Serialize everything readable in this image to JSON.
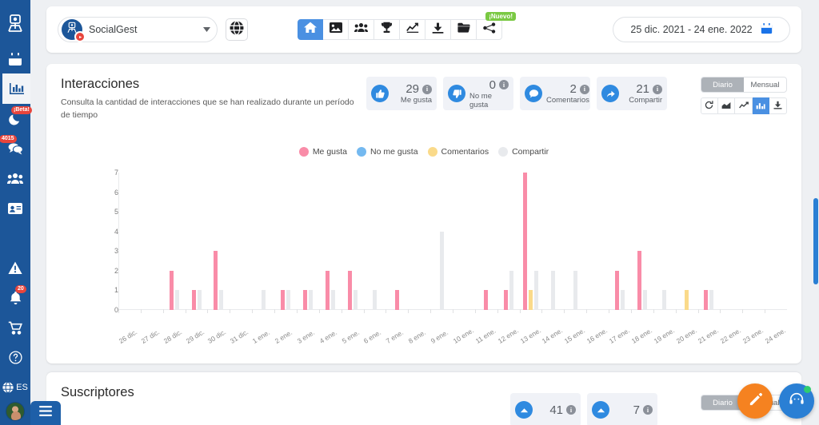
{
  "sidebar": {
    "items": [
      {
        "name": "logo",
        "icon": "logo-icon",
        "badge": null
      },
      {
        "name": "calendar",
        "icon": "calendar-icon",
        "badge": null
      },
      {
        "name": "analytics",
        "icon": "bar-chart-icon",
        "badge": null,
        "active": true
      },
      {
        "name": "moon",
        "icon": "moon-icon",
        "badge": "¡Beta!"
      },
      {
        "name": "messages",
        "icon": "chat-bubbles-icon",
        "badge": "4015"
      },
      {
        "name": "audience",
        "icon": "users-icon",
        "badge": null
      },
      {
        "name": "contacts",
        "icon": "id-card-icon",
        "badge": null
      },
      {
        "name": "alerts",
        "icon": "warning-triangle-icon",
        "badge": null
      },
      {
        "name": "notifications",
        "icon": "bell-icon",
        "badge": "20"
      },
      {
        "name": "store",
        "icon": "shopping-cart-icon",
        "badge": null
      },
      {
        "name": "help",
        "icon": "question-circle-icon",
        "badge": null
      }
    ],
    "language": "ES",
    "language_icon": "globe-icon",
    "avatar_name": "user-avatar",
    "menu_icon": "hamburger-menu-icon"
  },
  "topbar": {
    "account": {
      "name": "SocialGest",
      "avatar_icon": "socialgest-logo-icon",
      "platform_badge_icon": "youtube-icon",
      "chevron_icon": "chevron-down-icon"
    },
    "globe_button_icon": "globe-icon",
    "nav": [
      {
        "name": "home",
        "icon": "home-icon",
        "active": true
      },
      {
        "name": "publications",
        "icon": "image-icon",
        "active": false
      },
      {
        "name": "audience",
        "icon": "users-group-icon",
        "active": false
      },
      {
        "name": "competition",
        "icon": "trophy-icon",
        "active": false
      },
      {
        "name": "statistics",
        "icon": "line-chart-icon",
        "active": false
      },
      {
        "name": "downloads",
        "icon": "download-icon",
        "active": false
      },
      {
        "name": "library",
        "icon": "folder-icon",
        "active": false
      },
      {
        "name": "network",
        "icon": "share-network-icon",
        "active": false,
        "badge": "¡Nuevo!"
      }
    ],
    "date_range": "25 dic. 2021 - 24 ene. 2022",
    "date_icon": "calendar-icon"
  },
  "interactions_card": {
    "title": "Interacciones",
    "subtitle": "Consulta la cantidad de interacciones que se han realizado durante un período de tiempo",
    "stats": [
      {
        "value": "29",
        "label": "Me gusta",
        "icon": "thumbs-up-icon",
        "info_icon": "info-icon"
      },
      {
        "value": "0",
        "label": "No me gusta",
        "icon": "thumbs-down-icon",
        "info_icon": "info-icon"
      },
      {
        "value": "2",
        "label": "Comentarios",
        "icon": "comment-icon",
        "info_icon": "info-icon"
      },
      {
        "value": "21",
        "label": "Compartir",
        "icon": "share-arrow-icon",
        "info_icon": "info-icon"
      }
    ],
    "period_toggle": {
      "options": [
        "Diario",
        "Mensual"
      ],
      "selected": "Diario"
    },
    "chart_tools": [
      {
        "name": "refresh",
        "icon": "refresh-icon",
        "active": false
      },
      {
        "name": "area-chart",
        "icon": "area-chart-icon",
        "active": false
      },
      {
        "name": "line-chart",
        "icon": "line-chart-icon",
        "active": false
      },
      {
        "name": "bar-chart",
        "icon": "bar-chart-icon",
        "active": true
      },
      {
        "name": "export",
        "icon": "download-icon",
        "active": false
      }
    ]
  },
  "subscribers_card": {
    "title": "Suscriptores",
    "stats": [
      {
        "value": "41",
        "label": "",
        "icon": "subscriber-up-icon",
        "info_icon": "info-icon"
      },
      {
        "value": "7",
        "label": "",
        "icon": "subscriber-down-icon",
        "info_icon": "info-icon"
      }
    ],
    "period_toggle": {
      "options": [
        "Diario",
        "Mensual"
      ],
      "selected": "Diario"
    }
  },
  "fabs": [
    {
      "name": "compose",
      "icon": "pencil-icon",
      "color": "#f58220"
    },
    {
      "name": "support-chat",
      "icon": "chat-support-icon",
      "color": "#2a7fd4",
      "status_dot": "#2ecc71"
    }
  ],
  "colors": {
    "sidebar": "#1c5699",
    "accent_blue": "#4a90e2",
    "me_gusta": "#f98ca8",
    "no_me_gusta": "#74b9f0",
    "comentarios": "#fada8a",
    "compartir": "#e8eaed",
    "badge_red": "#e8453c",
    "badge_green": "#7ac943",
    "fab_orange": "#f58220"
  },
  "chart_data": {
    "type": "bar",
    "title": "Interacciones",
    "xlabel": "",
    "ylabel": "",
    "ylim": [
      0,
      7
    ],
    "yticks": [
      0,
      1,
      2,
      3,
      4,
      5,
      6,
      7
    ],
    "grid": false,
    "legend_position": "top-center",
    "categories": [
      "26 dic.",
      "27 dic.",
      "28 dic.",
      "29 dic.",
      "30 dic.",
      "31 dic.",
      "1 ene.",
      "2 ene.",
      "3 ene.",
      "4 ene.",
      "5 ene.",
      "6 ene.",
      "7 ene.",
      "8 ene.",
      "9 ene.",
      "10 ene.",
      "11 ene.",
      "12 ene.",
      "13 ene.",
      "14 ene.",
      "15 ene.",
      "16 ene.",
      "17 ene.",
      "18 ene.",
      "19 ene.",
      "20 ene.",
      "21 ene.",
      "22 ene.",
      "23 ene.",
      "24 ene."
    ],
    "series": [
      {
        "name": "Me gusta",
        "color": "#f98ca8",
        "values": [
          0,
          0,
          2,
          1,
          3,
          0,
          0,
          1,
          1,
          2,
          2,
          0,
          1,
          0,
          0,
          0,
          1,
          1,
          7,
          0,
          0,
          0,
          2,
          3,
          0,
          0,
          1,
          0,
          0,
          0
        ]
      },
      {
        "name": "No me gusta",
        "color": "#74b9f0",
        "values": [
          0,
          0,
          0,
          0,
          0,
          0,
          0,
          0,
          0,
          0,
          0,
          0,
          0,
          0,
          0,
          0,
          0,
          0,
          0,
          0,
          0,
          0,
          0,
          0,
          0,
          0,
          0,
          0,
          0,
          0
        ]
      },
      {
        "name": "Comentarios",
        "color": "#fada8a",
        "values": [
          0,
          0,
          0,
          0,
          0,
          0,
          0,
          0,
          0,
          0,
          0,
          0,
          0,
          0,
          0,
          0,
          0,
          0,
          1,
          0,
          0,
          0,
          0,
          0,
          0,
          1,
          0,
          0,
          0,
          0
        ]
      },
      {
        "name": "Compartir",
        "color": "#e8eaed",
        "values": [
          0,
          0,
          1,
          1,
          1,
          0,
          1,
          1,
          1,
          1,
          1,
          1,
          0,
          0,
          4,
          0,
          0,
          2,
          2,
          2,
          2,
          0,
          1,
          1,
          1,
          0,
          1,
          0,
          0,
          0
        ]
      }
    ]
  }
}
